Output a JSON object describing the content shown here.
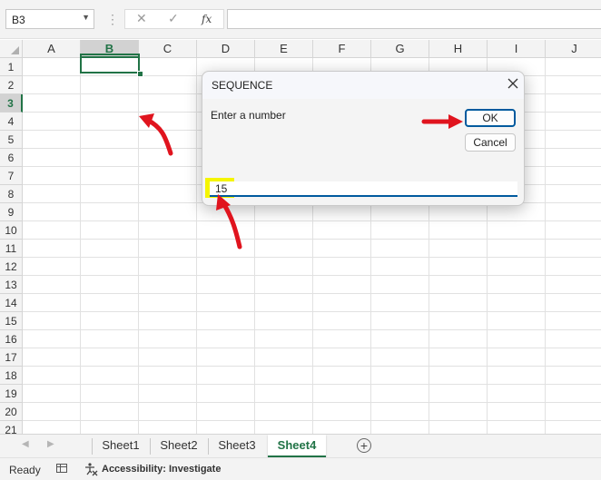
{
  "formula_bar": {
    "name_box": "B3",
    "cancel_icon": "x-icon",
    "enter_icon": "check-icon",
    "function_label": "fx",
    "formula_value": ""
  },
  "sheet": {
    "columns": [
      "A",
      "B",
      "C",
      "D",
      "E",
      "F",
      "G",
      "H",
      "I",
      "J"
    ],
    "rows": [
      "1",
      "2",
      "3",
      "4",
      "5",
      "6",
      "7",
      "8",
      "9",
      "10",
      "11",
      "12",
      "13",
      "14",
      "15",
      "16",
      "17",
      "18",
      "19",
      "20",
      "21"
    ],
    "selected_column": "B",
    "selected_row": "3",
    "active_cell": "B3"
  },
  "tabs": {
    "items": [
      "Sheet1",
      "Sheet2",
      "Sheet3",
      "Sheet4"
    ],
    "active": "Sheet4"
  },
  "status": {
    "ready": "Ready",
    "accessibility": "Accessibility: Investigate"
  },
  "dialog": {
    "title": "SEQUENCE",
    "prompt": "Enter a number",
    "ok_label": "OK",
    "cancel_label": "Cancel",
    "input_value": "15"
  },
  "colors": {
    "excel_green": "#217346",
    "annotation_red": "#e0141e",
    "highlight_yellow": "#ffff00",
    "input_accent": "#005a9e"
  }
}
